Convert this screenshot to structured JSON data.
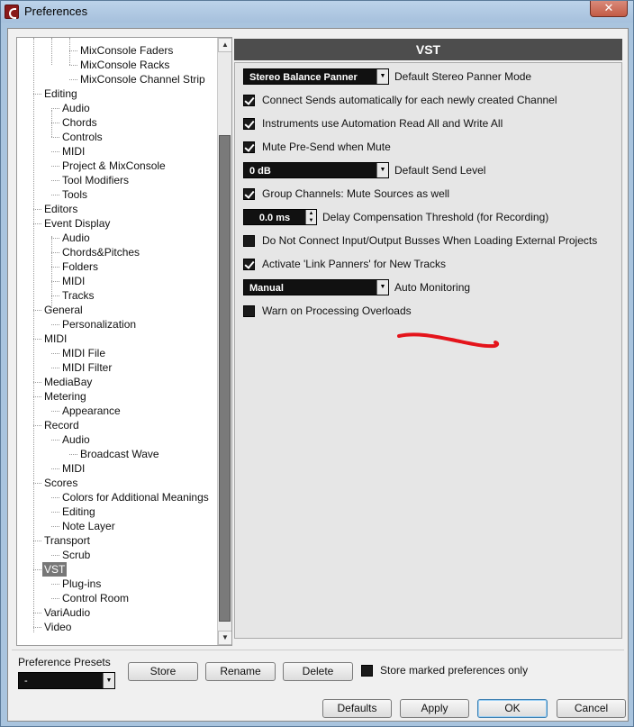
{
  "window": {
    "title": "Preferences",
    "close_label": "✕"
  },
  "tree": {
    "items": [
      {
        "label": "MixConsole Faders",
        "level": 2
      },
      {
        "label": "MixConsole Racks",
        "level": 2
      },
      {
        "label": "MixConsole Channel Strip",
        "level": 2
      },
      {
        "label": "Editing",
        "level": 0
      },
      {
        "label": "Audio",
        "level": 1
      },
      {
        "label": "Chords",
        "level": 1
      },
      {
        "label": "Controls",
        "level": 1
      },
      {
        "label": "MIDI",
        "level": 1
      },
      {
        "label": "Project & MixConsole",
        "level": 1
      },
      {
        "label": "Tool Modifiers",
        "level": 1
      },
      {
        "label": "Tools",
        "level": 1
      },
      {
        "label": "Editors",
        "level": 0
      },
      {
        "label": "Event Display",
        "level": 0
      },
      {
        "label": "Audio",
        "level": 1
      },
      {
        "label": "Chords&Pitches",
        "level": 1
      },
      {
        "label": "Folders",
        "level": 1
      },
      {
        "label": "MIDI",
        "level": 1
      },
      {
        "label": "Tracks",
        "level": 1
      },
      {
        "label": "General",
        "level": 0
      },
      {
        "label": "Personalization",
        "level": 1
      },
      {
        "label": "MIDI",
        "level": 0
      },
      {
        "label": "MIDI File",
        "level": 1
      },
      {
        "label": "MIDI Filter",
        "level": 1
      },
      {
        "label": "MediaBay",
        "level": 0
      },
      {
        "label": "Metering",
        "level": 0
      },
      {
        "label": "Appearance",
        "level": 1
      },
      {
        "label": "Record",
        "level": 0
      },
      {
        "label": "Audio",
        "level": 1
      },
      {
        "label": "Broadcast Wave",
        "level": 2
      },
      {
        "label": "MIDI",
        "level": 1
      },
      {
        "label": "Scores",
        "level": 0
      },
      {
        "label": "Colors for Additional Meanings",
        "level": 1
      },
      {
        "label": "Editing",
        "level": 1
      },
      {
        "label": "Note Layer",
        "level": 1
      },
      {
        "label": "Transport",
        "level": 0
      },
      {
        "label": "Scrub",
        "level": 1
      },
      {
        "label": "VST",
        "level": 0,
        "selected": true
      },
      {
        "label": "Plug-ins",
        "level": 1
      },
      {
        "label": "Control Room",
        "level": 1
      },
      {
        "label": "VariAudio",
        "level": 0
      },
      {
        "label": "Video",
        "level": 0
      }
    ]
  },
  "panel": {
    "title": "VST",
    "rows": [
      {
        "type": "dropdown",
        "value": "Stereo Balance Panner",
        "label": "Default Stereo Panner Mode"
      },
      {
        "type": "checkbox",
        "checked": true,
        "label": "Connect Sends automatically for each newly created Channel"
      },
      {
        "type": "checkbox",
        "checked": true,
        "label": "Instruments use Automation Read All and Write All"
      },
      {
        "type": "checkbox",
        "checked": true,
        "label": "Mute Pre-Send when Mute"
      },
      {
        "type": "dropdown",
        "value": "0 dB",
        "label": "Default Send Level"
      },
      {
        "type": "checkbox",
        "checked": true,
        "label": "Group Channels: Mute Sources as well"
      },
      {
        "type": "spin",
        "value": "0.0 ms",
        "label": "Delay Compensation Threshold (for Recording)"
      },
      {
        "type": "checkbox",
        "checked": false,
        "label": "Do Not Connect Input/Output Busses When Loading External Projects"
      },
      {
        "type": "checkbox",
        "checked": true,
        "label": "Activate 'Link Panners' for New Tracks"
      },
      {
        "type": "dropdown",
        "value": "Manual",
        "label": "Auto Monitoring"
      },
      {
        "type": "checkbox",
        "checked": false,
        "label": "Warn on Processing Overloads"
      }
    ],
    "annotation_color": "#e4141b"
  },
  "footer": {
    "presets_label": "Preference Presets",
    "presets_value": "-",
    "store_label": "Store",
    "rename_label": "Rename",
    "delete_label": "Delete",
    "store_marked_label": "Store marked preferences only",
    "defaults_label": "Defaults",
    "apply_label": "Apply",
    "ok_label": "OK",
    "cancel_label": "Cancel"
  }
}
